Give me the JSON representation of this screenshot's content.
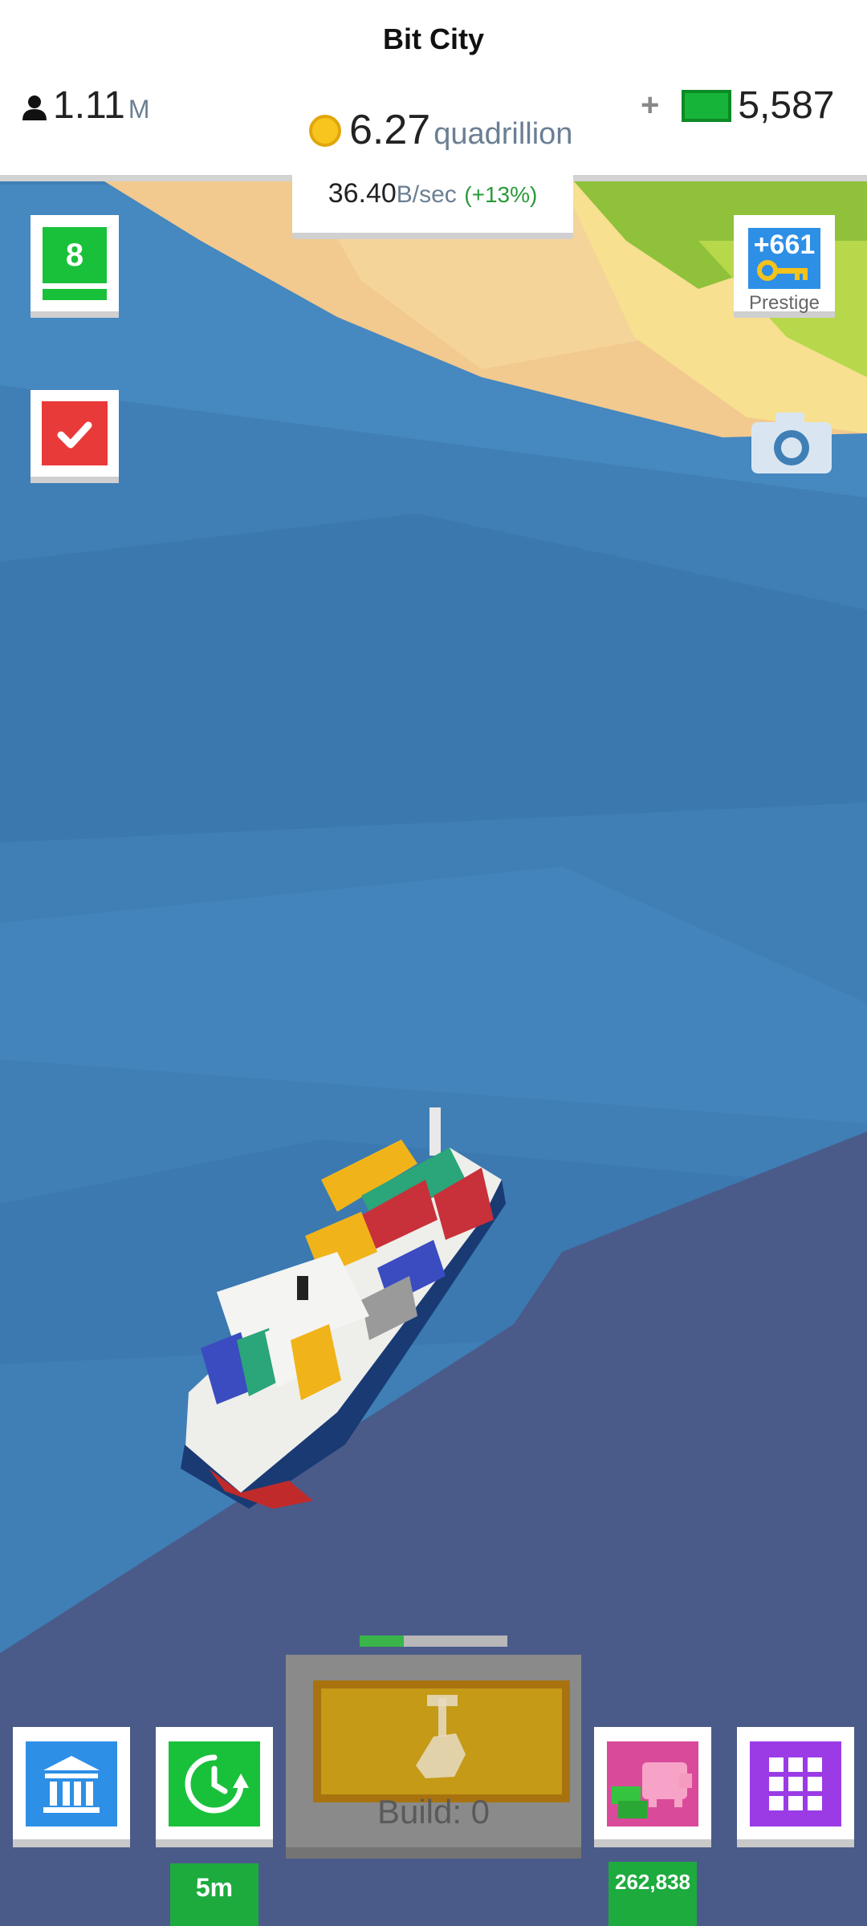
{
  "header": {
    "city_name": "Bit City",
    "population_value": "1.11",
    "population_unit": "M",
    "money_value": "6.27",
    "money_unit": "quadrillion",
    "rate_value": "36.40",
    "rate_unit": "B/sec",
    "rate_bonus": "(+13%)",
    "cash_plus": "+",
    "cash_value": "5,587"
  },
  "left_panel": {
    "level": "8"
  },
  "prestige": {
    "amount": "+661",
    "label": "Prestige"
  },
  "bottom_bar": {
    "timer_badge": "5m",
    "piggy_badge": "262,838",
    "build_label": "Build: 0",
    "build_progress": 0.3
  },
  "icons": {
    "population": "person-icon",
    "money": "coin-icon",
    "cash": "cash-bill-icon",
    "missions": "checkmark-icon",
    "prestige": "key-icon",
    "screenshot": "camera-icon",
    "bank": "bank-icon",
    "timer": "clock-refresh-icon",
    "build": "hammer-hand-icon",
    "piggy": "piggy-bank-icon",
    "menu": "grid-menu-icon"
  },
  "colors": {
    "sea": "#3f7fb6",
    "land_sand": "#f2c98f",
    "land_grass": "#8fc13a",
    "deep_shelf": "#4a5b8a",
    "level_green": "#19c13a",
    "missions_red": "#e93a3a",
    "prestige_blue": "#2d8fe6",
    "bank_blue": "#2d8fe6",
    "timer_green": "#19c13a",
    "piggy_pink": "#d94a9a",
    "menu_purple": "#9b3be6",
    "bonus_green": "#2a9a3a"
  }
}
